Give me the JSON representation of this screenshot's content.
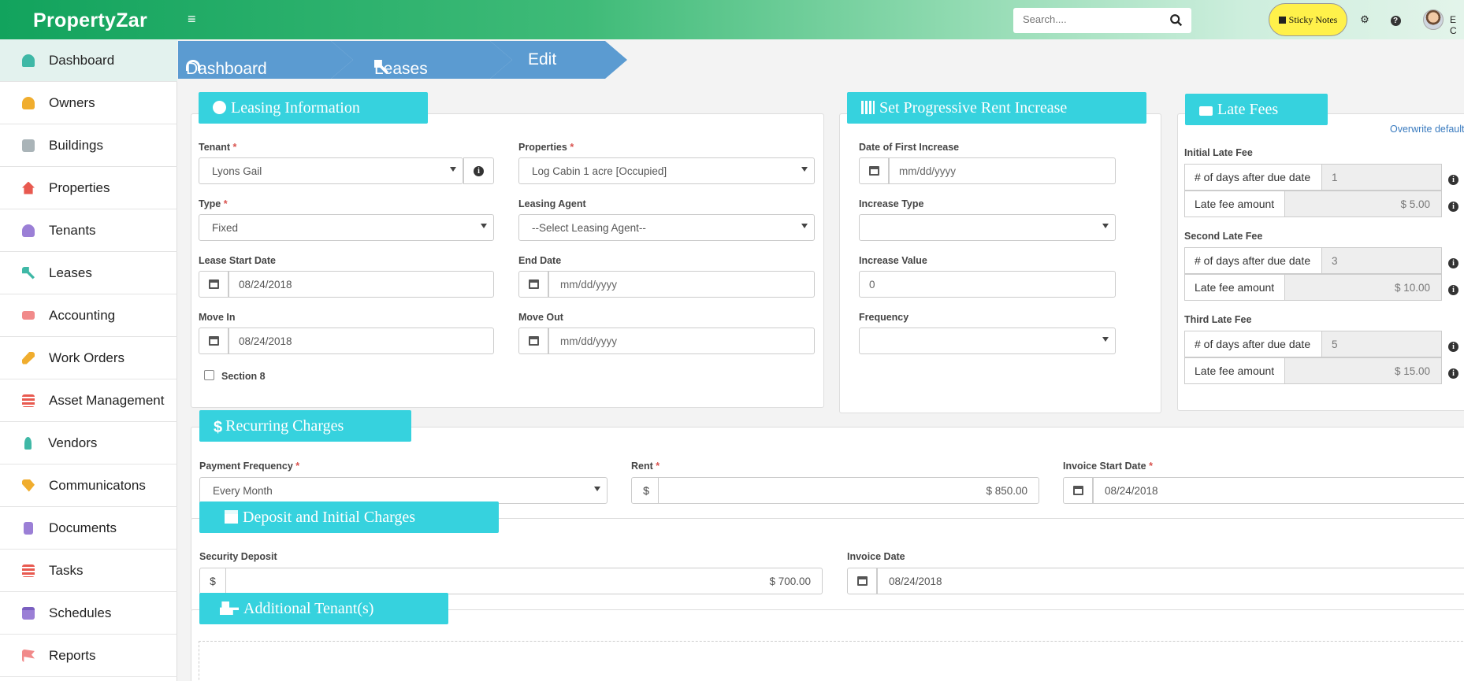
{
  "topbar": {
    "brand": "PropertyZar",
    "search_placeholder": "Search....",
    "sticky_notes": "Sticky Notes",
    "user_initials": "E C"
  },
  "sidebar": {
    "items": [
      {
        "label": "Dashboard",
        "icon": "dashboard-icon",
        "color": "#3fb8a6",
        "active": true
      },
      {
        "label": "Owners",
        "icon": "user-icon",
        "color": "#f0ad2e"
      },
      {
        "label": "Buildings",
        "icon": "building-icon",
        "color": "#aab4b8"
      },
      {
        "label": "Properties",
        "icon": "home-icon",
        "color": "#e8594f"
      },
      {
        "label": "Tenants",
        "icon": "users-icon",
        "color": "#9b7fd6"
      },
      {
        "label": "Leases",
        "icon": "key-icon",
        "color": "#3fb8a6"
      },
      {
        "label": "Accounting",
        "icon": "money-icon",
        "color": "#f18a8a"
      },
      {
        "label": "Work Orders",
        "icon": "wrench-icon",
        "color": "#f0ad2e"
      },
      {
        "label": "Asset Management",
        "icon": "list-icon",
        "color": "#e8594f"
      },
      {
        "label": "Vendors",
        "icon": "person-icon",
        "color": "#3fb8a6"
      },
      {
        "label": "Communicatons",
        "icon": "tags-icon",
        "color": "#f0ad2e"
      },
      {
        "label": "Documents",
        "icon": "file-icon",
        "color": "#9b7fd6"
      },
      {
        "label": "Tasks",
        "icon": "tasks-icon",
        "color": "#e8594f"
      },
      {
        "label": "Schedules",
        "icon": "calendar-icon",
        "color": "#9b7fd6"
      },
      {
        "label": "Reports",
        "icon": "flag-icon",
        "color": "#f18a8a"
      }
    ]
  },
  "breadcrumb": {
    "dashboard": "Dashboard",
    "leases": "Leases",
    "edit": "Edit"
  },
  "leasing": {
    "title": "Leasing Information",
    "tenant_label": "Tenant",
    "tenant_value": "Lyons Gail",
    "properties_label": "Properties",
    "properties_value": "Log Cabin 1 acre [Occupied]",
    "type_label": "Type",
    "type_value": "Fixed",
    "agent_label": "Leasing Agent",
    "agent_value": "--Select Leasing Agent--",
    "start_label": "Lease Start Date",
    "start_value": "08/24/2018",
    "end_label": "End Date",
    "end_placeholder": "mm/dd/yyyy",
    "movein_label": "Move In",
    "movein_value": "08/24/2018",
    "moveout_label": "Move Out",
    "moveout_placeholder": "mm/dd/yyyy",
    "section8_label": "Section 8",
    "required_mark": "*"
  },
  "progressive": {
    "title": "Set Progressive Rent Increase",
    "first_label": "Date of First Increase",
    "first_placeholder": "mm/dd/yyyy",
    "type_label": "Increase Type",
    "value_label": "Increase Value",
    "value_placeholder": "0",
    "freq_label": "Frequency"
  },
  "late_fees": {
    "title": "Late Fees",
    "overwrite": "Overwrite default",
    "days_label": "# of days after due date",
    "amount_label": "Late fee amount",
    "groups": [
      {
        "title": "Initial Late Fee",
        "days": "1",
        "amount": "$ 5.00"
      },
      {
        "title": "Second Late Fee",
        "days": "3",
        "amount": "$ 10.00"
      },
      {
        "title": "Third Late Fee",
        "days": "5",
        "amount": "$ 15.00"
      }
    ]
  },
  "recurring": {
    "title": "Recurring Charges",
    "freq_label": "Payment Frequency",
    "freq_value": "Every Month",
    "rent_label": "Rent",
    "rent_value": "$ 850.00",
    "invoice_start_label": "Invoice Start Date",
    "invoice_start_value": "08/24/2018",
    "currency": "$"
  },
  "deposit": {
    "title": "Deposit and Initial Charges",
    "security_label": "Security Deposit",
    "security_value": "$ 700.00",
    "invoice_label": "Invoice Date",
    "invoice_value": "08/24/2018",
    "currency": "$"
  },
  "additional": {
    "title": "Additional Tenant(s)"
  }
}
